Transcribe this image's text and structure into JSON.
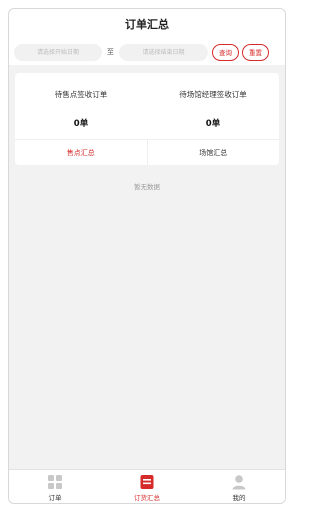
{
  "header": {
    "title": "订单汇总"
  },
  "filter": {
    "start_placeholder": "请选择开始日期",
    "separator": "至",
    "end_placeholder": "请选择结束日期",
    "query_label": "查询",
    "reset_label": "重置"
  },
  "summary": {
    "stats": [
      {
        "label": "待售点签收订单",
        "value": "0单"
      },
      {
        "label": "待场馆经理签收订单",
        "value": "0单"
      }
    ],
    "tabs": [
      {
        "label": "售点汇总",
        "active": true
      },
      {
        "label": "场馆汇总",
        "active": false
      }
    ]
  },
  "empty_text": "暂无数据",
  "tabbar": {
    "items": [
      {
        "label": "订单",
        "icon": "grid-icon",
        "active": false
      },
      {
        "label": "订货汇总",
        "icon": "summary-icon",
        "active": true
      },
      {
        "label": "我的",
        "icon": "person-icon",
        "active": false
      }
    ]
  },
  "colors": {
    "accent": "#d72a2a",
    "background": "#f2f2f2",
    "inactive_icon": "#c8c8c8"
  }
}
